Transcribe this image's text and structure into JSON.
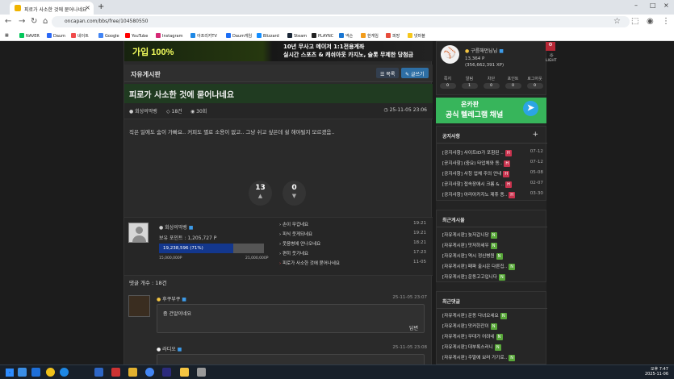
{
  "browser": {
    "tab_title": "피로가 사소한 것에 묻어나네요",
    "url": "oncapan.com/bbs/free/104580550"
  },
  "bookmarks": [
    {
      "label": "NAVER",
      "color": "#03c75a"
    },
    {
      "label": "Daum",
      "color": "#2b68f6"
    },
    {
      "label": "네이트",
      "color": "#f04b4b"
    },
    {
      "label": "Google",
      "color": "#4285f4"
    },
    {
      "label": "YouTube",
      "color": "#ff0000"
    },
    {
      "label": "Instagram",
      "color": "#d62976"
    },
    {
      "label": "아프리카TV",
      "color": "#1e88e5"
    },
    {
      "label": "Daum게임",
      "color": "#1d6ef5"
    },
    {
      "label": "Blizzard",
      "color": "#148eff"
    },
    {
      "label": "Steam",
      "color": "#1b2838"
    },
    {
      "label": "PLAYNC",
      "color": "#222"
    },
    {
      "label": "넥슨",
      "color": "#1976d2"
    },
    {
      "label": "한게임",
      "color": "#f29c1b"
    },
    {
      "label": "피망",
      "color": "#e74c3c"
    },
    {
      "label": "넷마블",
      "color": "#f6c71b"
    }
  ],
  "banner": {
    "left": "가입 100%",
    "right_line1": "10년 무사고 메이저 1:1전용계좌",
    "right_line2": "실시간 스포츠 & 캐쉬아웃 카지노, 슬롯 무제한 당첨금"
  },
  "board": {
    "title": "자유게시판",
    "list_button": "목록",
    "write_button": "글쓰기"
  },
  "post": {
    "title": "피로가 사소한 것에 묻어나네요",
    "author": "회상의딱뱅",
    "comments": "18건",
    "views": "30회",
    "datetime": "25-11-05 23:06",
    "body": "직은 일에도 숨이 가빠요.. 커피도 별로 소용이 없고.. 그냥 쉬고 싶은데 쉴 해야될지 모르겠음..",
    "upvotes": "13",
    "downvotes": "0"
  },
  "author_box": {
    "name": "회상의딱뱅",
    "points": "보유 포인트 : 1,205,727 P",
    "progress_label": "19,238,596 (71%)",
    "progress": 0.71,
    "scale_min": "15,000,000P",
    "scale_max": "21,000,000P",
    "recent": [
      {
        "title": "손이 무겁네요",
        "time": "19:21"
      },
      {
        "title": "피식 웃게되네요",
        "time": "19:21"
      },
      {
        "title": "웃음병에 안나오네요",
        "time": "18:21"
      },
      {
        "title": "편히 웃기네요",
        "time": "17:23"
      },
      {
        "title": "피로가 사소한 것에 묻어나네요",
        "time": "11-05"
      }
    ]
  },
  "comments": {
    "count_label": "댓글 개수 : 18건",
    "items": [
      {
        "author": "후쿠부쿠",
        "time": "25-11-05 23:07",
        "text": "좀 건알이네요",
        "reply": "답변"
      },
      {
        "author": "라디오",
        "time": "25-11-05 23:08",
        "text": "",
        "reply": ""
      }
    ]
  },
  "sidebar": {
    "profile": {
      "name": "구름해먼님님",
      "points": "13,364 P",
      "exp": "(356,662,391 XP)"
    },
    "stats": [
      {
        "label": "쪽지",
        "value": "0"
      },
      {
        "label": "알림",
        "value": "1"
      },
      {
        "label": "차단",
        "value": "0"
      },
      {
        "label": "포인트",
        "value": "0"
      },
      {
        "label": "로그아웃",
        "value": "0"
      }
    ],
    "ad": {
      "title": "온카판",
      "subtitle": "공식 텔레그램 채널"
    },
    "notice": {
      "title": "공지사항",
      "items": [
        {
          "label": "[공지사항] 사이트ID가 포함된 ..",
          "date": "07-12"
        },
        {
          "label": "[공지사항] (중요) 타업체와 동..",
          "date": "07-12"
        },
        {
          "label": "[공지사항] 사칭 업체 주의 안내",
          "date": "05-08"
        },
        {
          "label": "[공지사항] 접속장애시 크롬 & ..",
          "date": "02-07"
        },
        {
          "label": "[공지사항] 아리아카지노 제휴 종..",
          "date": "03-30"
        }
      ]
    },
    "recent_posts": {
      "title": "최근게시물",
      "items": [
        "[자유게시판] 늦저갑니당",
        "[자유게시판] 맛저하세우",
        "[자유게시판] 역시 정신병원",
        "[자유게시판] 패파 출시은 다른집..",
        "[자유게시판] 운동고고입니다"
      ]
    },
    "recent_comments": {
      "title": "최근댓글",
      "items": [
        "[자유게시판] 운동 다녀오세요",
        "[자유게시판] 맛커한잔이",
        "[자유게시판] 무대가 어려네",
        "[자유게시판] 대부록스러니",
        "[자유게시판] 주말에 보러 가기로.."
      ]
    }
  },
  "side_controls": {
    "light": "LIGHT"
  },
  "taskbar": {
    "time": "오후 7:47",
    "date": "2025-11-06"
  }
}
